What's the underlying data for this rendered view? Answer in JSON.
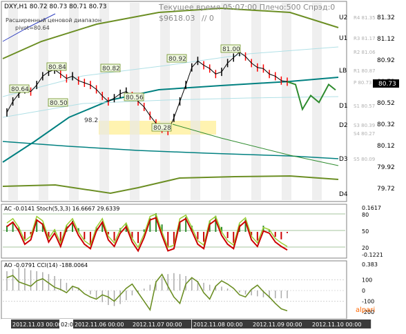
{
  "header": {
    "symbol_line": "DXY,H1  80.72 80.73 80.71 80.73",
    "server_time": "Текущее время 05:07:00 Плечо:500 Спрэд:0",
    "balance": "$9618.03",
    "note": "// 0",
    "range_label_1": "Расширенный ценовой диапазон",
    "range_label_2": "pivot=80.64"
  },
  "colors": {
    "background": "#ffffff",
    "grid_band": "#e8e8e8",
    "price_line": "#000000",
    "up_bar": "#000000",
    "down_bar": "#ff0000",
    "blue_ma": "#008080",
    "olive_envelope": "#6b8e23",
    "light_channel": "#b0e0e6",
    "forecast": "#2e8b2e",
    "ac_line": "#cc0000",
    "stoch_line": "#9acd32",
    "cci_line": "#6b8e23",
    "highlight_zone": "#fff3b0"
  },
  "chart_data": [
    {
      "type": "line",
      "panel": "price",
      "title": "DXY,H1",
      "x": [
        "2012.11.03 00:00",
        "02:00",
        "2012.11.06 00:00",
        "2012.11.07 00:00",
        "2012.11.08 00:00",
        "2012.11.09 00:00",
        "2012.11.10 00:00"
      ],
      "ylim": [
        79.65,
        81.45
      ],
      "y_ticks": [
        "81.32",
        "81.12",
        "80.92",
        "80.73",
        "80.52",
        "80.32",
        "80.12",
        "79.92",
        "79.72"
      ],
      "series": [
        {
          "name": "close",
          "values": [
            80.45,
            80.55,
            80.62,
            80.66,
            80.64,
            80.7,
            80.78,
            80.82,
            80.84,
            80.8,
            80.76,
            80.78,
            80.74,
            80.72,
            80.7,
            80.66,
            80.6,
            80.55,
            80.58,
            80.62,
            80.64,
            80.6,
            80.55,
            80.5,
            80.42,
            80.35,
            80.3,
            80.28,
            80.4,
            80.55,
            80.7,
            80.86,
            80.92,
            80.88,
            80.85,
            80.8,
            80.82,
            80.9,
            80.95,
            81.0,
            80.96,
            80.9,
            80.86,
            80.85,
            80.8,
            80.78,
            80.74,
            80.73
          ]
        }
      ],
      "price_labels": [
        {
          "text": "80.64"
        },
        {
          "text": "80.84"
        },
        {
          "text": "80.50"
        },
        {
          "text": "80.82"
        },
        {
          "text": "80.56"
        },
        {
          "text": "80.92"
        },
        {
          "text": "81.00"
        },
        {
          "text": "80.28"
        },
        {
          "text": "98.2"
        }
      ],
      "pivot_levels": [
        {
          "name": "U2",
          "label": "R4 81.35"
        },
        {
          "name": "U1",
          "label": "R3 81.17"
        },
        {
          "name": "",
          "label": "R2 81.06"
        },
        {
          "name": "LB",
          "label": "R1 80.87"
        },
        {
          "name": "",
          "label": "P 80.73"
        },
        {
          "name": "D1",
          "label": "S1 80.57"
        },
        {
          "name": "D2",
          "label": "S3 80.39"
        },
        {
          "name": "",
          "label": "S4 80.27"
        },
        {
          "name": "D3",
          "label": "S5 80.09"
        },
        {
          "name": "D4",
          "label": ""
        }
      ],
      "current_price": "80.73"
    },
    {
      "type": "line",
      "panel": "oscillator",
      "title": "AC -0.0141  Stoch(5,3,3) 16.6667 29.6339",
      "y_ticks": [
        "0.1617",
        "80",
        "50",
        "20",
        "-0.1221"
      ],
      "ac_values": [
        0.05,
        0.08,
        0.04,
        -0.06,
        -0.02,
        0.1,
        0.07,
        -0.04,
        0.02,
        -0.08,
        0.05,
        0.09,
        0.03,
        -0.06,
        -0.1,
        0.04,
        0.08,
        -0.02,
        -0.07,
        0.03,
        0.06,
        -0.05,
        -0.09,
        0.02,
        0.11,
        0.15,
        0.06,
        -0.12,
        -0.1,
        0.08,
        0.12,
        0.05,
        -0.06,
        -0.08,
        0.09,
        0.13,
        0.04,
        -0.05,
        -0.09,
        0.06,
        0.1,
        -0.03,
        -0.07,
        0.05,
        0.02,
        -0.04,
        -0.06,
        -0.01
      ],
      "stoch_values": [
        70,
        80,
        60,
        30,
        40,
        85,
        75,
        35,
        55,
        25,
        65,
        80,
        50,
        30,
        20,
        60,
        80,
        40,
        25,
        55,
        70,
        35,
        15,
        45,
        85,
        90,
        50,
        15,
        20,
        80,
        88,
        60,
        30,
        20,
        75,
        85,
        50,
        30,
        20,
        70,
        82,
        40,
        25,
        60,
        55,
        35,
        25,
        17
      ]
    },
    {
      "type": "line",
      "panel": "oscillator",
      "title": "AO -0.0791  CCI(14) -188.0064",
      "y_ticks": [
        "0.383",
        "100",
        "0",
        "-100",
        "-200"
      ],
      "cci_values": [
        120,
        140,
        80,
        60,
        40,
        90,
        110,
        70,
        30,
        10,
        -20,
        40,
        20,
        -30,
        -60,
        -80,
        -40,
        -60,
        -100,
        -40,
        20,
        60,
        -20,
        -100,
        -180,
        80,
        150,
        40,
        -60,
        -120,
        60,
        120,
        80,
        -20,
        -80,
        40,
        90,
        60,
        20,
        -40,
        -60,
        10,
        50,
        -10,
        -60,
        -120,
        -170,
        -188
      ],
      "ao_values": [
        0.2,
        0.22,
        0.24,
        0.23,
        0.21,
        0.2,
        0.19,
        0.17,
        0.15,
        0.12,
        0.08,
        0.05,
        0.03,
        0.0,
        -0.04,
        -0.08,
        -0.12,
        -0.15,
        -0.16,
        -0.14,
        -0.1,
        -0.05,
        -0.02,
        0.02,
        0.06,
        0.1,
        0.14,
        0.17,
        0.18,
        0.17,
        0.15,
        0.13,
        0.1,
        0.08,
        0.06,
        0.05,
        0.04,
        0.02,
        0.0,
        -0.02,
        -0.04,
        -0.05,
        -0.06,
        -0.07,
        -0.08,
        -0.08,
        -0.08,
        -0.08
      ]
    }
  ],
  "watermark": "alpari"
}
